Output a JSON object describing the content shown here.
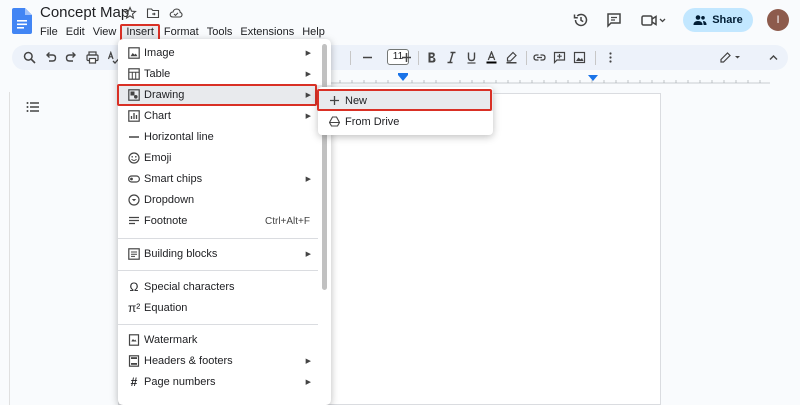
{
  "document": {
    "title": "Concept Map"
  },
  "menubar": {
    "items": [
      {
        "label": "File"
      },
      {
        "label": "Edit"
      },
      {
        "label": "View"
      },
      {
        "label": "Insert"
      },
      {
        "label": "Format"
      },
      {
        "label": "Tools"
      },
      {
        "label": "Extensions"
      },
      {
        "label": "Help"
      }
    ]
  },
  "share": {
    "label": "Share"
  },
  "user": {
    "initial": "I"
  },
  "toolbar": {
    "font_size": "11"
  },
  "insert_menu": {
    "items": [
      {
        "label": "Image",
        "icon": "image-icon",
        "submenu": true
      },
      {
        "label": "Table",
        "icon": "table-icon",
        "submenu": true
      },
      {
        "label": "Drawing",
        "icon": "drawing-icon",
        "submenu": true
      },
      {
        "label": "Chart",
        "icon": "chart-icon",
        "submenu": true
      },
      {
        "label": "Horizontal line",
        "icon": "horizontal-line-icon",
        "submenu": false
      },
      {
        "label": "Emoji",
        "icon": "emoji-icon",
        "submenu": false
      },
      {
        "label": "Smart chips",
        "icon": "smart-chips-icon",
        "submenu": true
      },
      {
        "label": "Dropdown",
        "icon": "dropdown-icon",
        "submenu": false
      },
      {
        "label": "Footnote",
        "icon": "footnote-icon",
        "submenu": false,
        "shortcut": "Ctrl+Alt+F"
      },
      {
        "label": "Building blocks",
        "icon": "building-blocks-icon",
        "submenu": true
      },
      {
        "label": "Special characters",
        "icon": "omega-icon",
        "submenu": false
      },
      {
        "label": "Equation",
        "icon": "pi-icon",
        "submenu": false
      },
      {
        "label": "Watermark",
        "icon": "watermark-icon",
        "submenu": false
      },
      {
        "label": "Headers & footers",
        "icon": "headers-footers-icon",
        "submenu": true
      },
      {
        "label": "Page numbers",
        "icon": "page-numbers-icon",
        "submenu": true
      }
    ]
  },
  "drawing_submenu": {
    "items": [
      {
        "label": "New",
        "icon": "plus-icon"
      },
      {
        "label": "From Drive",
        "icon": "drive-icon"
      }
    ]
  },
  "colors": {
    "accent": "#1a73e8",
    "highlight_border": "#d93025",
    "share_bg": "#c2e7ff",
    "toolbar_bg": "#edf2fa"
  }
}
